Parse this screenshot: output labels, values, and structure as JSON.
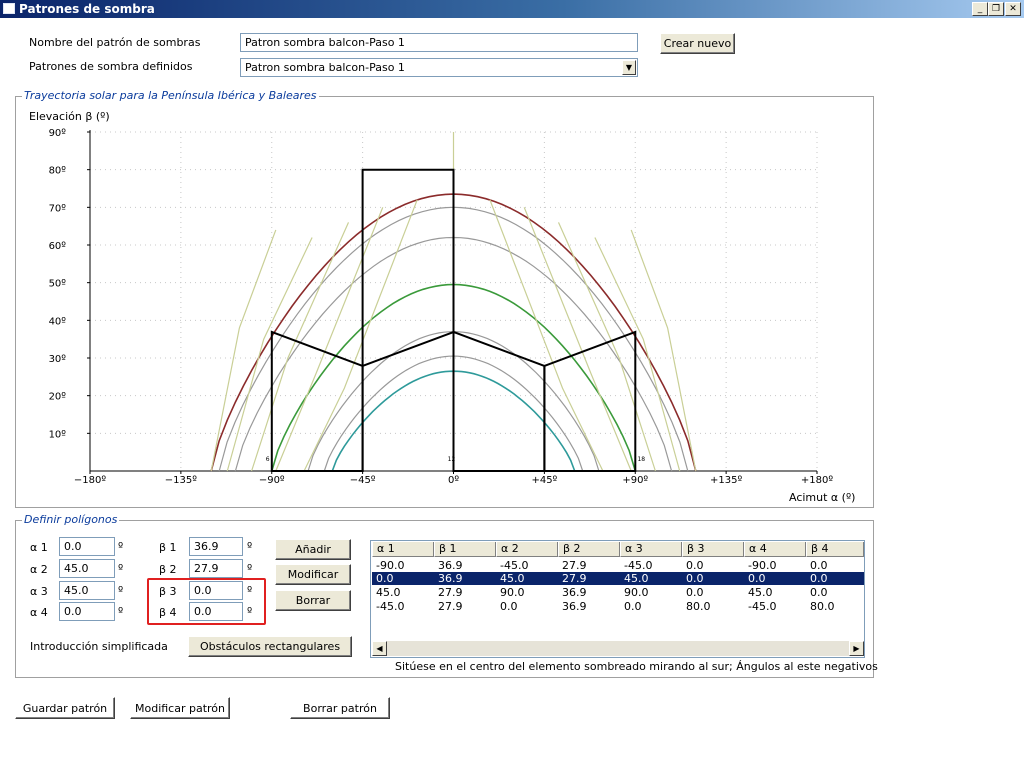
{
  "window": {
    "title": "Patrones de sombra",
    "minimize": "_",
    "restore": "❐",
    "close": "✕"
  },
  "pattern": {
    "name_label": "Nombre del patrón de sombras",
    "name_value": "Patron sombra balcon-Paso 1",
    "create_button": "Crear nuevo",
    "defined_label": "Patrones de sombra definidos",
    "defined_value": "Patron sombra balcon-Paso 1"
  },
  "chart_group": {
    "title": "Trayectoria solar para la Península Ibérica y Baleares"
  },
  "chart_data": {
    "type": "line",
    "ylabel": "Elevación β (º)",
    "xlabel": "Acimut α (º)",
    "xlim": [
      -180,
      180
    ],
    "ylim": [
      0,
      90
    ],
    "xticks": [
      -180,
      -135,
      -90,
      -45,
      0,
      45,
      90,
      135,
      180
    ],
    "xtick_labels": [
      "−180º",
      "−135º",
      "−90º",
      "−45º",
      "0º",
      "+45º",
      "+90º",
      "+135º",
      "+180º"
    ],
    "yticks": [
      10,
      20,
      30,
      40,
      50,
      60,
      70,
      80,
      90
    ],
    "ytick_labels": [
      "10º",
      "20º",
      "30º",
      "40º",
      "50º",
      "60º",
      "70º",
      "80º",
      "90º"
    ],
    "hour_labels": [
      {
        "azimuth": -92,
        "text": "6"
      },
      {
        "azimuth": -1,
        "text": "12"
      },
      {
        "azimuth": 93,
        "text": "18"
      }
    ],
    "grid": true,
    "sun_paths": [
      {
        "peak": 73.5,
        "half_width": 120,
        "color": "#8b2b2b",
        "width": 1.6
      },
      {
        "peak": 70,
        "half_width": 116,
        "color": "#999999",
        "width": 1.2
      },
      {
        "peak": 62,
        "half_width": 108,
        "color": "#999999",
        "width": 1.2
      },
      {
        "peak": 49.5,
        "half_width": 90,
        "color": "#3a9a3a",
        "width": 1.6
      },
      {
        "peak": 37,
        "half_width": 72,
        "color": "#999999",
        "width": 1.2
      },
      {
        "peak": 30.5,
        "half_width": 64,
        "color": "#999999",
        "width": 1.2
      },
      {
        "peak": 26.5,
        "half_width": 60,
        "color": "#2e9a9a",
        "width": 1.6
      }
    ],
    "hour_lines": [
      [
        [
          -120,
          0
        ],
        [
          -106,
          38
        ],
        [
          -88,
          64
        ]
      ],
      [
        [
          -112,
          0
        ],
        [
          -94,
          35
        ],
        [
          -70,
          62
        ]
      ],
      [
        [
          -100,
          0
        ],
        [
          -82,
          30
        ],
        [
          -52,
          66
        ]
      ],
      [
        [
          -88,
          0
        ],
        [
          -68,
          26
        ],
        [
          -35,
          70
        ]
      ],
      [
        [
          -74,
          0
        ],
        [
          -54,
          22
        ],
        [
          -18,
          72
        ]
      ],
      [
        [
          120,
          0
        ],
        [
          106,
          38
        ],
        [
          88,
          64
        ]
      ],
      [
        [
          112,
          0
        ],
        [
          94,
          35
        ],
        [
          70,
          62
        ]
      ],
      [
        [
          100,
          0
        ],
        [
          82,
          30
        ],
        [
          52,
          66
        ]
      ],
      [
        [
          88,
          0
        ],
        [
          68,
          26
        ],
        [
          35,
          70
        ]
      ],
      [
        [
          74,
          0
        ],
        [
          54,
          22
        ],
        [
          18,
          72
        ]
      ],
      [
        [
          0,
          0
        ],
        [
          0,
          90
        ]
      ]
    ],
    "shadow_polygons": [
      [
        [
          -90,
          0
        ],
        [
          -90,
          36.9
        ],
        [
          -45,
          27.9
        ],
        [
          -45,
          0
        ]
      ],
      [
        [
          0,
          0
        ],
        [
          0,
          36.9
        ],
        [
          45,
          27.9
        ],
        [
          45,
          0
        ]
      ],
      [
        [
          45,
          0
        ],
        [
          45,
          27.9
        ],
        [
          90,
          36.9
        ],
        [
          90,
          0
        ]
      ],
      [
        [
          -45,
          0
        ],
        [
          -45,
          80
        ],
        [
          0,
          80
        ],
        [
          0,
          36.9
        ],
        [
          -45,
          27.9
        ]
      ]
    ]
  },
  "polygons_group": {
    "title": "Definir polígonos"
  },
  "inputs": {
    "a1_label": "α 1",
    "a1": "0.0",
    "a2_label": "α 2",
    "a2": "45.0",
    "a3_label": "α 3",
    "a3": "45.0",
    "a4_label": "α 4",
    "a4": "0.0",
    "b1_label": "β 1",
    "b1": "36.9",
    "b2_label": "β 2",
    "b2": "27.9",
    "b3_label": "β 3",
    "b3": "0.0",
    "b4_label": "β 4",
    "b4": "0.0",
    "unit": "º"
  },
  "buttons": {
    "add": "Añadir",
    "modify": "Modificar",
    "delete": "Borrar"
  },
  "simplified": {
    "label": "Introducción simplificada",
    "button": "Obstáculos rectangulares"
  },
  "table": {
    "headers": [
      "α 1",
      "β 1",
      "α 2",
      "β 2",
      "α 3",
      "β 3",
      "α 4",
      "β 4"
    ],
    "rows": [
      [
        "-90.0",
        "36.9",
        "-45.0",
        "27.9",
        "-45.0",
        "0.0",
        "-90.0",
        "0.0"
      ],
      [
        "0.0",
        "36.9",
        "45.0",
        "27.9",
        "45.0",
        "0.0",
        "0.0",
        "0.0"
      ],
      [
        "45.0",
        "27.9",
        "90.0",
        "36.9",
        "90.0",
        "0.0",
        "45.0",
        "0.0"
      ],
      [
        "-45.0",
        "27.9",
        "0.0",
        "36.9",
        "0.0",
        "80.0",
        "-45.0",
        "80.0"
      ]
    ],
    "selected_row": 1,
    "scroll_left": "◀",
    "scroll_right": "▶"
  },
  "note": "Sitúese en el centro del elemento sombreado mirando al sur; Ángulos al este negativos",
  "bottom": {
    "save": "Guardar patrón",
    "modify": "Modificar patrón",
    "delete": "Borrar patrón"
  }
}
